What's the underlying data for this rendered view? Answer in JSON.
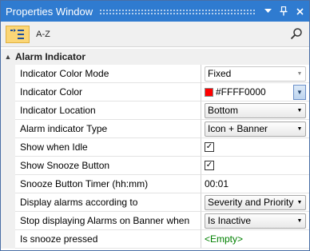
{
  "window": {
    "title": "Properties Window"
  },
  "titlebar": {
    "dropdown_icon": "dropdown-arrow-icon",
    "pin_icon": "pin-icon",
    "close_icon": "close-icon"
  },
  "toolbar": {
    "categorized_icon": "categorized-icon",
    "alphabetical_label": "A-Z",
    "search_icon": "search-icon"
  },
  "category": {
    "title": "Alarm Indicator"
  },
  "rows": [
    {
      "name": "Indicator Color Mode",
      "value": "Fixed"
    },
    {
      "name": "Indicator Color",
      "value": "#FFFF0000",
      "color": "#ff0000"
    },
    {
      "name": "Indicator Location",
      "value": "Bottom"
    },
    {
      "name": "Alarm indicator Type",
      "value": "Icon + Banner"
    },
    {
      "name": "Show when Idle",
      "value": "✓"
    },
    {
      "name": "Show Snooze Button",
      "value": "✓"
    },
    {
      "name": "Snooze Button Timer (hh:mm)",
      "value": "00:01"
    },
    {
      "name": "Display alarms according to",
      "value": "Severity and Priority"
    },
    {
      "name": "Stop displaying Alarms on Banner when",
      "value": "Is Inactive"
    },
    {
      "name": "Is snooze pressed",
      "value": "<Empty>"
    }
  ]
}
